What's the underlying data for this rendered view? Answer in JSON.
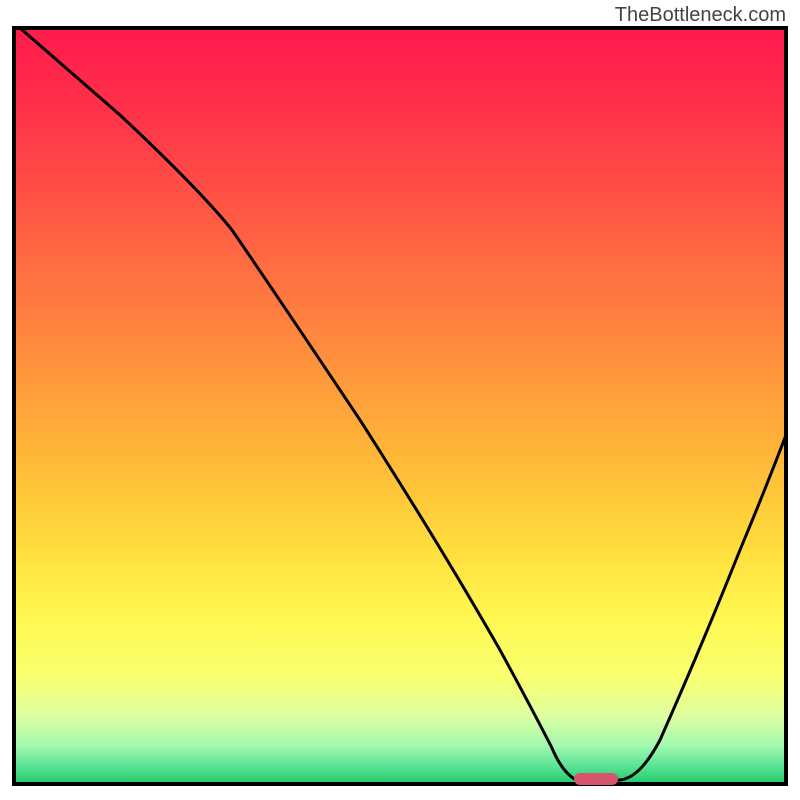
{
  "watermark": "TheBottleneck.com",
  "chart_data": {
    "type": "line",
    "title": "",
    "xlabel": "",
    "ylabel": "",
    "xlim": [
      0,
      100
    ],
    "ylim": [
      0,
      100
    ],
    "background": {
      "type": "gradient",
      "stops": [
        {
          "offset": 0,
          "color": "#ff1744"
        },
        {
          "offset": 15,
          "color": "#ff3b47"
        },
        {
          "offset": 35,
          "color": "#ff7242"
        },
        {
          "offset": 55,
          "color": "#ffb238"
        },
        {
          "offset": 70,
          "color": "#ffe440"
        },
        {
          "offset": 82,
          "color": "#fff95e"
        },
        {
          "offset": 90,
          "color": "#e0ff80"
        },
        {
          "offset": 95,
          "color": "#b0ffa0"
        },
        {
          "offset": 99,
          "color": "#40e080"
        },
        {
          "offset": 100,
          "color": "#20c860"
        }
      ]
    },
    "curve": {
      "x": [
        1,
        12,
        25,
        40,
        55,
        64,
        68,
        73,
        78,
        85,
        92,
        100
      ],
      "y": [
        100,
        88,
        74,
        52,
        30,
        13,
        4,
        0,
        0,
        10,
        30,
        55
      ]
    },
    "marker": {
      "x": 74.5,
      "y": 0,
      "color": "#d6556b",
      "width": 5,
      "height": 1.5
    }
  }
}
